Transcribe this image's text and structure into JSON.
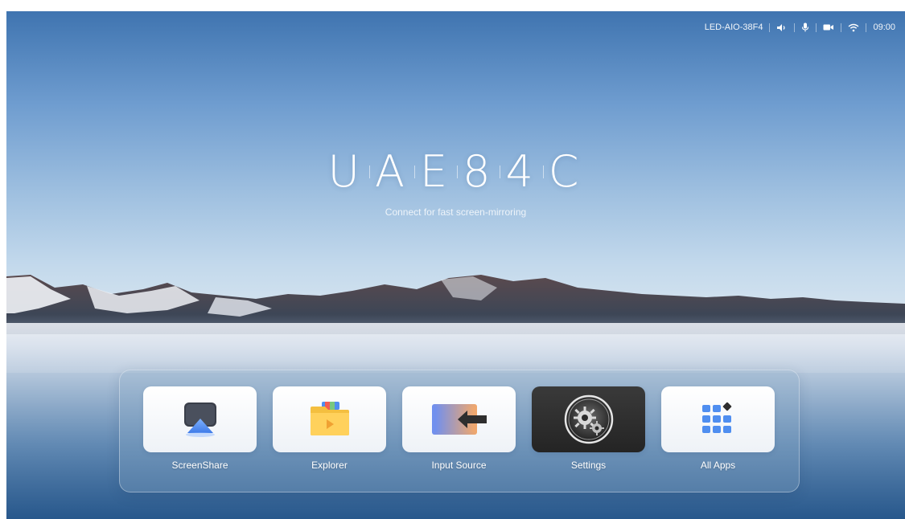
{
  "status_bar": {
    "device_name": "LED-AIO-38F4",
    "icons": [
      "volume-icon",
      "microphone-icon",
      "camera-icon",
      "wifi-icon"
    ],
    "time": "09:00"
  },
  "hero": {
    "title_chars": [
      "U",
      "A",
      "E",
      "8",
      "4",
      "C"
    ],
    "subtitle": "Connect for fast screen-mirroring"
  },
  "dock": {
    "apps": [
      {
        "label": "ScreenShare",
        "icon": "screenshare-icon",
        "active": false
      },
      {
        "label": "Explorer",
        "icon": "folder-icon",
        "active": false
      },
      {
        "label": "Input Source",
        "icon": "input-source-icon",
        "active": false
      },
      {
        "label": "Settings",
        "icon": "gear-icon",
        "active": true
      },
      {
        "label": "All Apps",
        "icon": "app-grid-icon",
        "active": false
      }
    ]
  },
  "colors": {
    "sky_top": "#3f74b0",
    "dock_bg": "#8caac8",
    "active_tile": "#2a2a2a",
    "accent_blue": "#4f8ef0"
  }
}
